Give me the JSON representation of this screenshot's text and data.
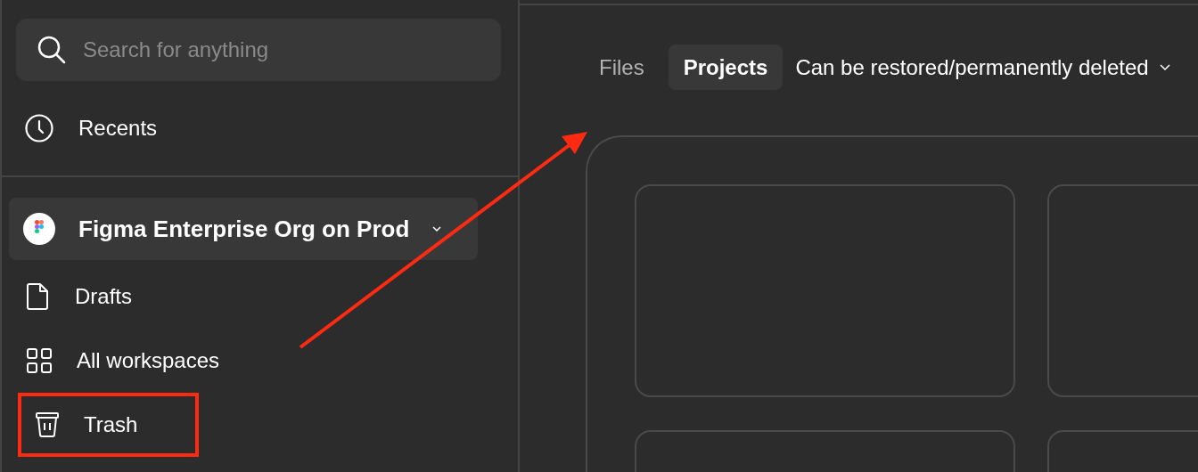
{
  "search": {
    "placeholder": "Search for anything"
  },
  "recents": {
    "label": "Recents"
  },
  "org": {
    "name": "Figma Enterprise Org on Prod"
  },
  "nav": [
    {
      "label": "Drafts",
      "kind": "file",
      "highlighted": false
    },
    {
      "label": "All workspaces",
      "kind": "grid",
      "highlighted": false
    },
    {
      "label": "Trash",
      "kind": "trash",
      "highlighted": true
    }
  ],
  "tabs": [
    {
      "label": "Files",
      "selected": false
    },
    {
      "label": "Projects",
      "selected": true
    }
  ],
  "filter": {
    "label": "Can be restored/permanently deleted"
  },
  "projects": [
    {
      "kind": "placeholder"
    },
    {
      "kind": "placeholder"
    },
    {
      "kind": "placeholder"
    },
    {
      "kind": "placeholder"
    }
  ]
}
